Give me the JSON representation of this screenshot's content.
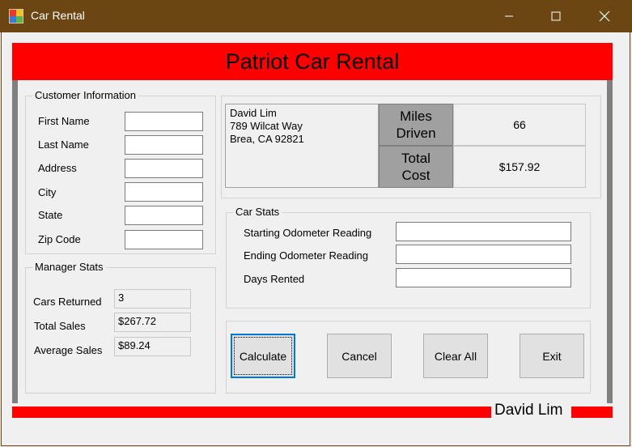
{
  "window": {
    "title": "Car Rental"
  },
  "banner": {
    "title": "Patriot Car Rental"
  },
  "customer_info": {
    "label": "Customer Information",
    "fields": [
      {
        "label": "First Name",
        "value": ""
      },
      {
        "label": "Last Name",
        "value": ""
      },
      {
        "label": "Address",
        "value": ""
      },
      {
        "label": "City",
        "value": ""
      },
      {
        "label": "State",
        "value": ""
      },
      {
        "label": "Zip Code",
        "value": ""
      }
    ]
  },
  "manager_stats": {
    "label": "Manager Stats",
    "rows": [
      {
        "label": "Cars Returned",
        "value": "3"
      },
      {
        "label": "Total Sales",
        "value": "$267.72"
      },
      {
        "label": "Average Sales",
        "value": "$89.24"
      }
    ]
  },
  "summary": {
    "customer_text": "David Lim\n789 Wilcat Way\nBrea, CA 92821",
    "miles_label": "Miles\nDriven",
    "miles_value": "66",
    "cost_label": "Total\nCost",
    "cost_value": "$157.92"
  },
  "car_stats": {
    "label": "Car Stats",
    "fields": [
      {
        "label": "Starting Odometer Reading",
        "value": ""
      },
      {
        "label": "Ending Odometer Reading",
        "value": ""
      },
      {
        "label": "Days Rented",
        "value": ""
      }
    ]
  },
  "buttons": {
    "calculate": "Calculate",
    "cancel": "Cancel",
    "clear_all": "Clear All",
    "exit": "Exit"
  },
  "footer": {
    "name": "David Lim"
  },
  "colors": {
    "titlebar": "#6b4613",
    "banner": "#ff0000",
    "focus": "#0078d7"
  }
}
